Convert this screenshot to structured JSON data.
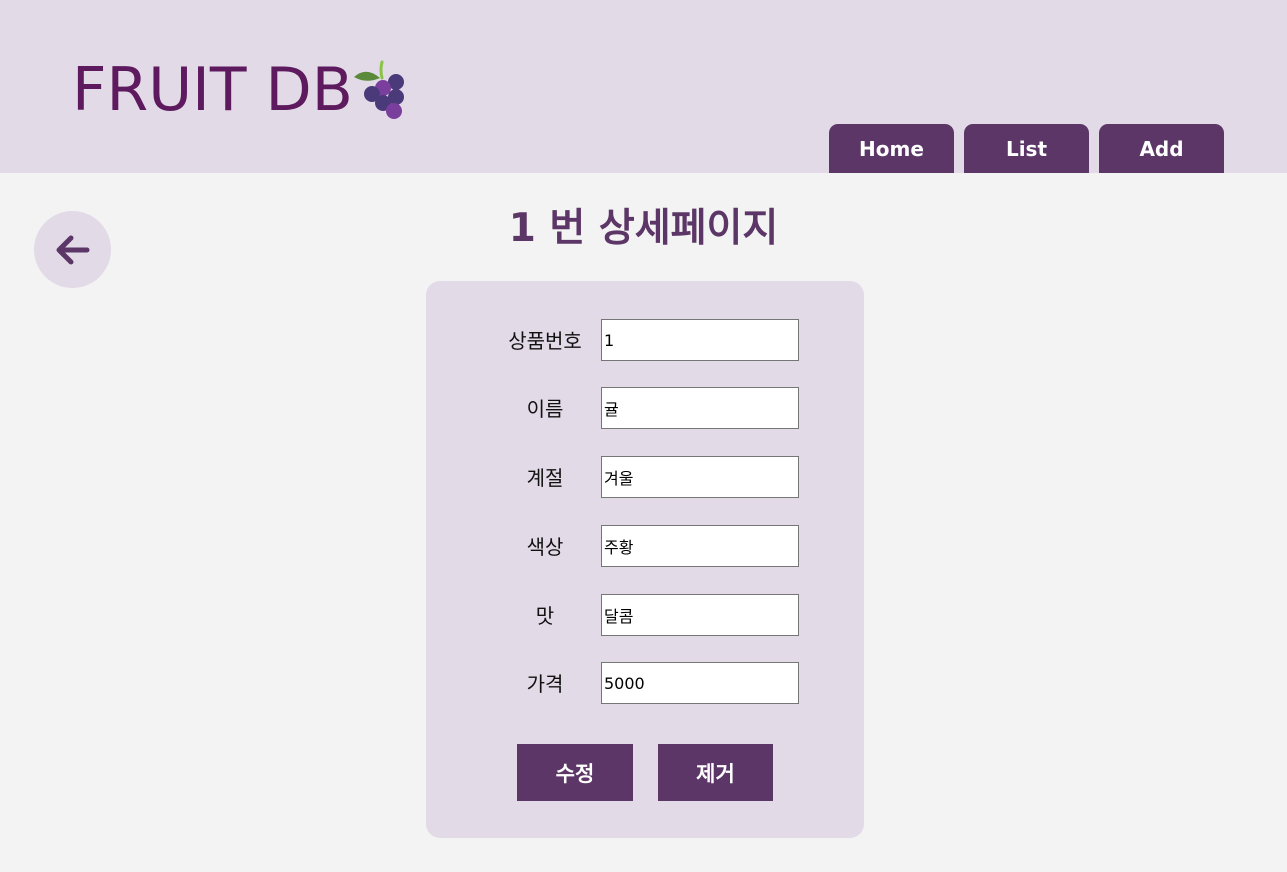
{
  "header": {
    "logo_text": "FRUIT DB",
    "logo_icon": "grape-icon",
    "nav": [
      {
        "label": "Home"
      },
      {
        "label": "List"
      },
      {
        "label": "Add"
      }
    ]
  },
  "back_icon": "arrow-left-icon",
  "page_title": "1 번 상세페이지",
  "form": {
    "fields": [
      {
        "label": "상품번호",
        "value": "1"
      },
      {
        "label": "이름",
        "value": "귤"
      },
      {
        "label": "계절",
        "value": "겨울"
      },
      {
        "label": "색상",
        "value": "주황"
      },
      {
        "label": "맛",
        "value": "달콤"
      },
      {
        "label": "가격",
        "value": "5000"
      }
    ],
    "edit_label": "수정",
    "delete_label": "제거"
  },
  "colors": {
    "header_bg": "#e2dae7",
    "accent": "#5b3667",
    "logo": "#5e1a5e",
    "page_bg": "#f3f3f3"
  }
}
